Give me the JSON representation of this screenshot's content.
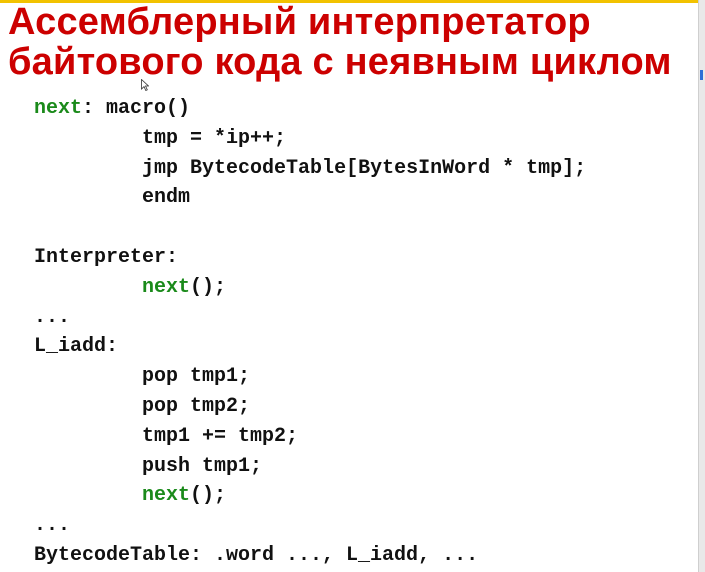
{
  "colors": {
    "title": "#cc0000",
    "keyword": "#1a8a1a",
    "code": "#111111",
    "top_stripe": "#f2c200"
  },
  "title": {
    "line1": "Ассемблерный интерпретатор",
    "line2": "байтового кода с неявным циклом"
  },
  "code": {
    "l01_kw": "next",
    "l01_rest": ": macro()",
    "l02": "tmp = *ip++;",
    "l03": "jmp BytecodeTable[BytesInWord * tmp];",
    "l04": "endm",
    "l06": "Interpreter:",
    "l07_kw": "next",
    "l07_rest": "();",
    "l08": "...",
    "l09": "L_iadd:",
    "l10": "pop tmp1;",
    "l11": "pop tmp2;",
    "l12": "tmp1 += tmp2;",
    "l13": "push tmp1;",
    "l14_kw": "next",
    "l14_rest": "();",
    "l15": "...",
    "l16": "BytecodeTable: .word ..., L_iadd, ..."
  },
  "icons": {
    "cursor": "mouse-pointer-icon"
  }
}
